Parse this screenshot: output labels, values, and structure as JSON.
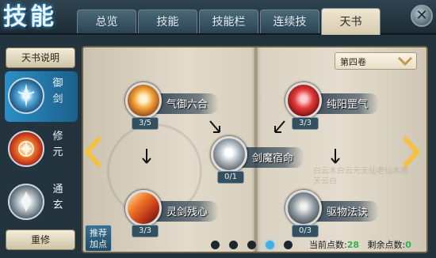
{
  "header": {
    "title": "技能",
    "tabs": [
      {
        "label": "总览"
      },
      {
        "label": "技能"
      },
      {
        "label": "技能栏"
      },
      {
        "label": "连续技"
      },
      {
        "label": "天书"
      }
    ],
    "close_symbol": "✕"
  },
  "sidebar": {
    "explain_label": "天书说明",
    "categories": [
      {
        "label": "御剑",
        "icon": "sword-emblem-icon",
        "active": true
      },
      {
        "label": "修元",
        "icon": "fire-seal-icon",
        "active": false
      },
      {
        "label": "通玄",
        "icon": "mystic-orb-icon",
        "active": false
      }
    ],
    "reset_label": "重修"
  },
  "book": {
    "volume_label": "第四卷",
    "skills": [
      {
        "name": "气御六合",
        "count": "3/5",
        "icon": "fire-orb-icon"
      },
      {
        "name": "纯阳罡气",
        "count": "3/3",
        "icon": "red-crystal-icon"
      },
      {
        "name": "剑魔宿命",
        "count": "0/1",
        "icon": "silver-sword-icon"
      },
      {
        "name": "灵剑残心",
        "count": "3/3",
        "icon": "flame-blade-icon"
      },
      {
        "name": "驱物法诀",
        "count": "0/3",
        "icon": "grey-spirit-icon"
      }
    ],
    "ink_text": "白云木白云元无仙老仙木南天云白"
  },
  "footer": {
    "recommend_label": "推荐加点",
    "page_count": 5,
    "active_page": 4,
    "current_points_label": "当前点数:",
    "current_points": "28",
    "remaining_points_label": "剩余点数:",
    "remaining_points": "0"
  },
  "colors": {
    "accent": "#3fb0e6",
    "points_green": "#2fb44a",
    "nav_arrow": "#f2c23c"
  }
}
